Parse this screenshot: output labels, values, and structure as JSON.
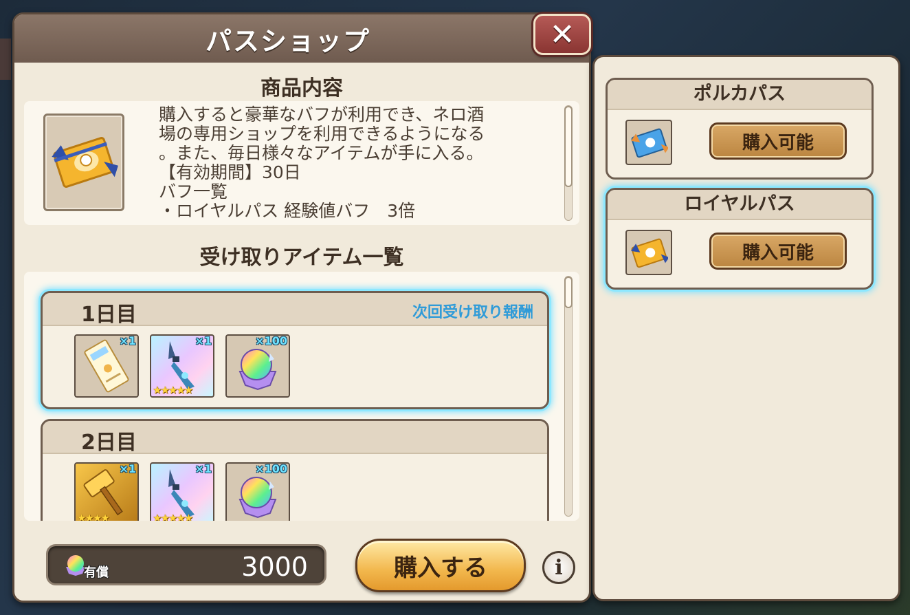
{
  "shop": {
    "title": "パスショップ",
    "close_label": "✕",
    "product_section_title": "商品内容",
    "product_description": "購入すると豪華なバフが利用でき、ネロ酒\n場の専用ショップを利用できるようになる\n。また、毎日様々なアイテムが手に入る。\n【有効期間】30日\nバフ一覧\n・ロイヤルパス 経験値バフ　3倍",
    "rewards_section_title": "受け取りアイテム一覧",
    "days": [
      {
        "label": "1日目",
        "next_reward_label": "次回受け取り報酬",
        "items": [
          {
            "icon": "ticket-icon",
            "qty": "×1",
            "stars": ""
          },
          {
            "icon": "staff-icon",
            "qty": "×1",
            "stars": "★★★★★"
          },
          {
            "icon": "rainbow-orb-icon",
            "qty": "×100",
            "stars": ""
          }
        ]
      },
      {
        "label": "2日目",
        "items": [
          {
            "icon": "gold-hammer-icon",
            "qty": "×1",
            "stars": "★★★★"
          },
          {
            "icon": "staff-icon",
            "qty": "×1",
            "stars": "★★★★★"
          },
          {
            "icon": "rainbow-orb-icon",
            "qty": "×100",
            "stars": ""
          }
        ]
      }
    ],
    "currency": {
      "label": "有償",
      "amount": "3000",
      "icon": "paid-gem-icon"
    },
    "buy_label": "購入する",
    "info_label": "i"
  },
  "passes": [
    {
      "name": "ポルカパス",
      "button_label": "購入可能",
      "icon": "blue-pass-icon",
      "selected": false
    },
    {
      "name": "ロイヤルパス",
      "button_label": "購入可能",
      "icon": "gold-pass-icon",
      "selected": true
    }
  ],
  "colors": {
    "panel_bg": "#f1eadb",
    "header_bg": "#7c685b",
    "highlight": "#7ee0ff",
    "next_reward": "#2f9bd8",
    "button_gold": "#f2b74d"
  }
}
